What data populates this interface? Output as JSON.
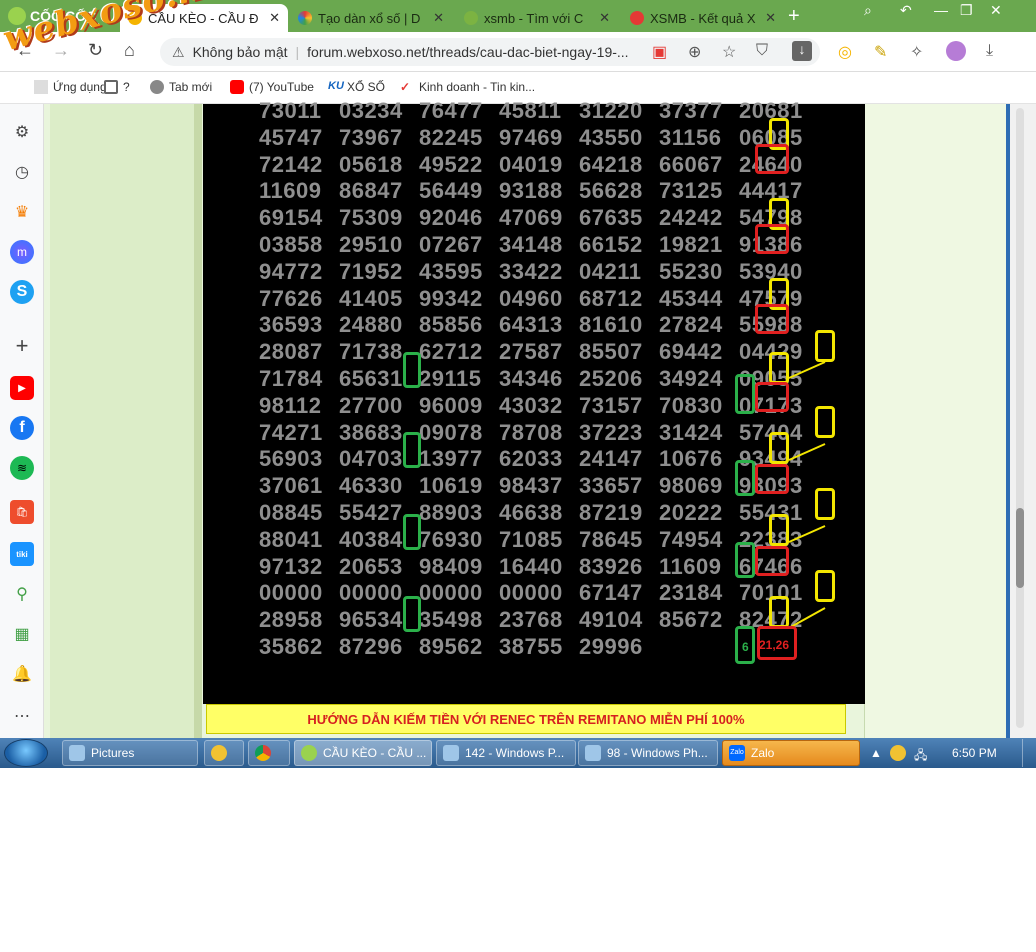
{
  "browser": {
    "brand": "CỐC CỐC",
    "tabs": [
      {
        "label": "CẦU KÈO - CẦU Đ",
        "active": true,
        "icon": "xs-icon"
      },
      {
        "label": "Tạo dàn xổ số | D",
        "active": false,
        "icon": "colorful-icon"
      },
      {
        "label": "xsmb - Tìm với C",
        "active": false,
        "icon": "coccoc-search-icon"
      },
      {
        "label": "XSMB - Kết quả X",
        "active": false,
        "icon": "xsmb-icon"
      }
    ],
    "security_label": "Không bảo mật",
    "url": "forum.webxoso.net/threads/cau-dac-biet-ngay-19-...",
    "bookmarks": [
      {
        "label": "Ứng dụng",
        "icon": "apps-icon"
      },
      {
        "label": "?",
        "icon": "folder-icon"
      },
      {
        "label": "Tab mới",
        "icon": "globe-icon"
      },
      {
        "label": "(7) YouTube",
        "icon": "youtube-icon"
      },
      {
        "label": "XỔ SỐ",
        "icon": "ku-icon"
      },
      {
        "label": "Kinh doanh - Tin kin...",
        "icon": "check-icon"
      }
    ],
    "watermark": "webxoso.net"
  },
  "lottery": {
    "rows": [
      [
        "73011",
        "03234",
        "76477",
        "45811",
        "31220",
        "37377",
        "20681"
      ],
      [
        "45747",
        "73967",
        "82245",
        "97469",
        "43550",
        "31156",
        "06085"
      ],
      [
        "72142",
        "05618",
        "49522",
        "04019",
        "64218",
        "66067",
        "24640"
      ],
      [
        "11609",
        "86847",
        "56449",
        "93188",
        "56628",
        "73125",
        "44417"
      ],
      [
        "69154",
        "75309",
        "92046",
        "47069",
        "67635",
        "24242",
        "54798"
      ],
      [
        "03858",
        "29510",
        "07267",
        "34148",
        "66152",
        "19821",
        "91386"
      ],
      [
        "94772",
        "71952",
        "43595",
        "33422",
        "04211",
        "55230",
        "53940"
      ],
      [
        "77626",
        "41405",
        "99342",
        "04960",
        "68712",
        "45344",
        "47579"
      ],
      [
        "36593",
        "24880",
        "85856",
        "64313",
        "81610",
        "27824",
        "55988"
      ],
      [
        "28087",
        "71738",
        "62712",
        "27587",
        "85507",
        "69442",
        "04429"
      ],
      [
        "71784",
        "65631",
        "29115",
        "34346",
        "25206",
        "34924",
        "09055"
      ],
      [
        "98112",
        "27700",
        "96009",
        "43032",
        "73157",
        "70830",
        "07173"
      ],
      [
        "74271",
        "38683",
        "09078",
        "78708",
        "37223",
        "31424",
        "57404"
      ],
      [
        "56903",
        "04703",
        "13977",
        "62033",
        "24147",
        "10676",
        "93494"
      ],
      [
        "37061",
        "46330",
        "10619",
        "98437",
        "33657",
        "98069",
        "93093"
      ],
      [
        "08845",
        "55427",
        "88903",
        "46638",
        "87219",
        "20222",
        "55431"
      ],
      [
        "88041",
        "40384",
        "76930",
        "71085",
        "78645",
        "74954",
        "22383"
      ],
      [
        "97132",
        "20653",
        "98409",
        "16440",
        "83926",
        "11609",
        "67466"
      ],
      [
        "00000",
        "00000",
        "00000",
        "00000",
        "67147",
        "23184",
        "70101"
      ],
      [
        "28958",
        "96534",
        "35498",
        "23768",
        "49104",
        "85672",
        "82472"
      ],
      [
        "35862",
        "87296",
        "89562",
        "38755",
        "29996",
        "",
        ""
      ]
    ],
    "answer_left": "6",
    "answer_main": "21,26",
    "banner": "HƯỚNG DẪN KIẾM TIỀN VỚI RENEC TRÊN REMITANO MIỄN PHÍ 100%"
  },
  "taskbar": {
    "items": [
      {
        "label": "Pictures",
        "icon": "folder-icon"
      },
      {
        "label": "",
        "icon": "plus-icon"
      },
      {
        "label": "",
        "icon": "chrome-icon"
      },
      {
        "label": "CẦU KÈO - CẦU ...",
        "icon": "coccoc-icon"
      },
      {
        "label": "142 - Windows P...",
        "icon": "photo-viewer-icon"
      },
      {
        "label": "98 - Windows Ph...",
        "icon": "photo-viewer-icon"
      },
      {
        "label": "Zalo",
        "icon": "zalo-icon"
      }
    ],
    "clock": "6:50 PM"
  },
  "colors": {
    "highlight_yellow": "#f3e600",
    "highlight_red": "#e02020",
    "highlight_green": "#2bb04a",
    "digits": "#8f8f8f",
    "banner_bg": "#ffff66",
    "banner_text": "#d62020"
  }
}
